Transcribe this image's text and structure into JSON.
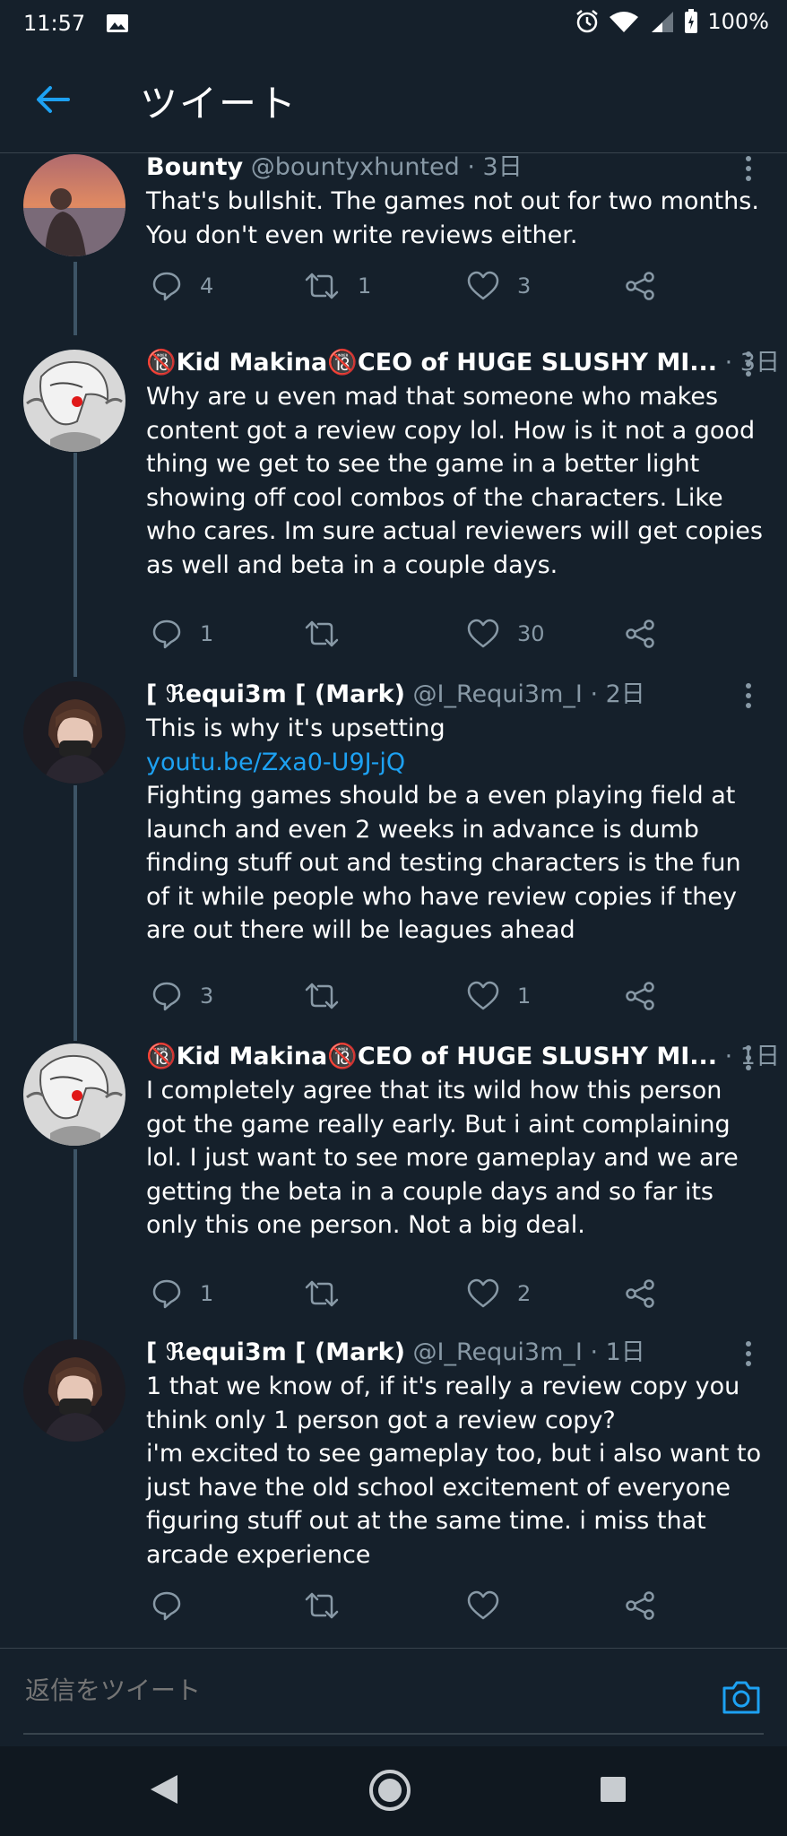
{
  "status_bar": {
    "time": "11:57",
    "battery": "100%"
  },
  "header": {
    "title": "ツイート"
  },
  "tweets": [
    {
      "name": "Bounty",
      "handle": "@bountyxhunted",
      "time": "· 3日",
      "body": [
        "That's bullshit. The games not out for two months. You don't even write reviews either."
      ],
      "replies": "4",
      "retweets": "1",
      "likes": "3"
    },
    {
      "name": "🔞Kid Makina🔞CEO of HUGE SLUSHY MI...",
      "handle": "",
      "time": "· 3日",
      "body": [
        "Why are u even mad that someone who makes content got a review copy lol. How is it not a good thing we get to see the game in a better light showing off cool combos of the characters. Like who cares. Im sure actual reviewers will get copies as well and beta in a couple days."
      ],
      "replies": "1",
      "retweets": "",
      "likes": "30"
    },
    {
      "name": "[ ℜequi3m [ (Mark)",
      "handle": "@I_Requi3m_I",
      "time": "· 2日",
      "body_before": "This is why it's upsetting",
      "link": "youtu.be/Zxa0-U9J-jQ",
      "body_after": "Fighting games should be a even playing field at launch and even 2 weeks in advance is dumb finding stuff out and testing characters is the fun of it while people who have review copies if they are out there will be leagues ahead",
      "replies": "3",
      "retweets": "",
      "likes": "1"
    },
    {
      "name": "🔞Kid Makina🔞CEO of HUGE SLUSHY MI...",
      "handle": "",
      "time": "· 1日",
      "body": [
        "I completely agree that its wild how this person got the game really early. But i aint complaining lol. I just want to see more gameplay and we are getting the beta in a couple days and so far its only this one person. Not a big deal."
      ],
      "replies": "1",
      "retweets": "",
      "likes": "2"
    },
    {
      "name": "[ ℜequi3m [ (Mark)",
      "handle": "@I_Requi3m_I",
      "time": "· 1日",
      "body": [
        "1 that we know of, if it's really a review copy you think only 1 person got a review copy?",
        "i'm excited to see gameplay too, but i also want to just have the old school excitement of everyone figuring stuff out at the same time. i miss that arcade experience"
      ],
      "replies": "",
      "retweets": "",
      "likes": ""
    }
  ],
  "reply_bar": {
    "placeholder": "返信をツイート"
  },
  "colors": {
    "background": "#15202b",
    "accent": "#1da1f2",
    "secondary_text": "#8899a6",
    "divider": "#38444d"
  },
  "icons": [
    "image-icon",
    "alarm-icon",
    "wifi-icon",
    "signal-icon",
    "battery-icon",
    "back-arrow-icon",
    "more-icon",
    "reply-icon",
    "retweet-icon",
    "like-icon",
    "share-icon",
    "camera-icon"
  ]
}
